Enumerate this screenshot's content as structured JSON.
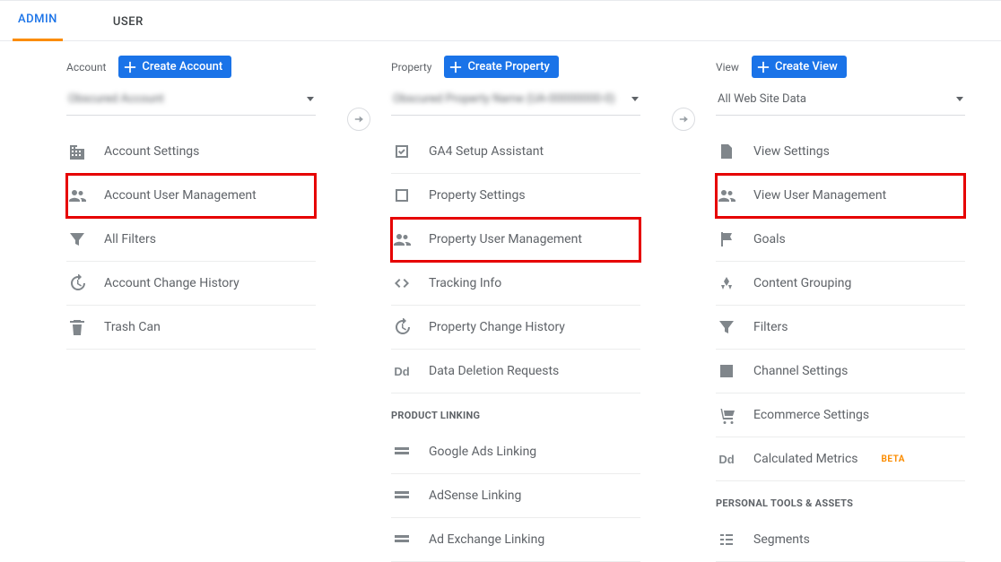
{
  "tabs": {
    "admin": "ADMIN",
    "user": "USER"
  },
  "account": {
    "label": "Account",
    "create": "Create Account",
    "selected": "Obscured Account",
    "items": [
      {
        "label": "Account Settings"
      },
      {
        "label": "Account User Management",
        "hl": true
      },
      {
        "label": "All Filters"
      },
      {
        "label": "Account Change History"
      },
      {
        "label": "Trash Can"
      }
    ]
  },
  "property": {
    "label": "Property",
    "create": "Create Property",
    "selected": "Obscured Property Name (UA-00000000-0)",
    "items": [
      {
        "label": "GA4 Setup Assistant"
      },
      {
        "label": "Property Settings"
      },
      {
        "label": "Property User Management",
        "hl": true
      },
      {
        "label": "Tracking Info"
      },
      {
        "label": "Property Change History"
      },
      {
        "label": "Data Deletion Requests"
      }
    ],
    "section": "PRODUCT LINKING",
    "linking": [
      {
        "label": "Google Ads Linking"
      },
      {
        "label": "AdSense Linking"
      },
      {
        "label": "Ad Exchange Linking"
      }
    ]
  },
  "view": {
    "label": "View",
    "create": "Create View",
    "selected": "All Web Site Data",
    "items": [
      {
        "label": "View Settings"
      },
      {
        "label": "View User Management",
        "hl": true
      },
      {
        "label": "Goals"
      },
      {
        "label": "Content Grouping"
      },
      {
        "label": "Filters"
      },
      {
        "label": "Channel Settings"
      },
      {
        "label": "Ecommerce Settings"
      },
      {
        "label": "Calculated Metrics",
        "beta": "BETA"
      }
    ],
    "section": "PERSONAL TOOLS & ASSETS",
    "personal": [
      {
        "label": "Segments"
      }
    ]
  }
}
